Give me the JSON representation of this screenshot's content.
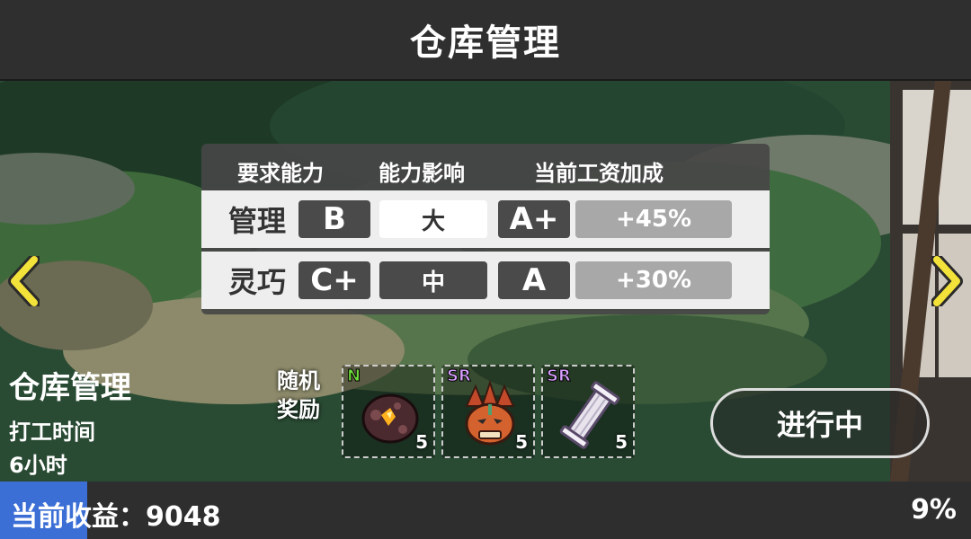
{
  "header": {
    "title": "仓库管理"
  },
  "info_table": {
    "columns": [
      "要求能力",
      "能力影响",
      "当前工资加成"
    ],
    "rows": [
      {
        "ability": "管理",
        "grade": "B",
        "impact": "大",
        "current_grade": "A+",
        "bonus": "+45%"
      },
      {
        "ability": "灵巧",
        "grade": "C+",
        "impact": "中",
        "current_grade": "A",
        "bonus": "+30%"
      }
    ]
  },
  "job": {
    "name": "仓库管理",
    "time_label": "打工时间",
    "time_value": "6小时"
  },
  "rewards": {
    "label_line1": "随机",
    "label_line2": "奖励",
    "items": [
      {
        "rarity": "N",
        "rarity_color": "#6fdc3b",
        "count": "5",
        "icon": "ore-icon"
      },
      {
        "rarity": "SR",
        "rarity_color": "#d8a0ff",
        "count": "5",
        "icon": "mask-icon"
      },
      {
        "rarity": "SR",
        "rarity_color": "#d8a0ff",
        "count": "5",
        "icon": "column-icon"
      }
    ]
  },
  "status_button": {
    "label": "进行中"
  },
  "footer": {
    "earnings_label": "当前收益：9048",
    "progress_percent": "9%",
    "progress_value": 0.09,
    "progress_color": "#3b6fd6"
  },
  "colors": {
    "arrow": "#f2e23a"
  }
}
